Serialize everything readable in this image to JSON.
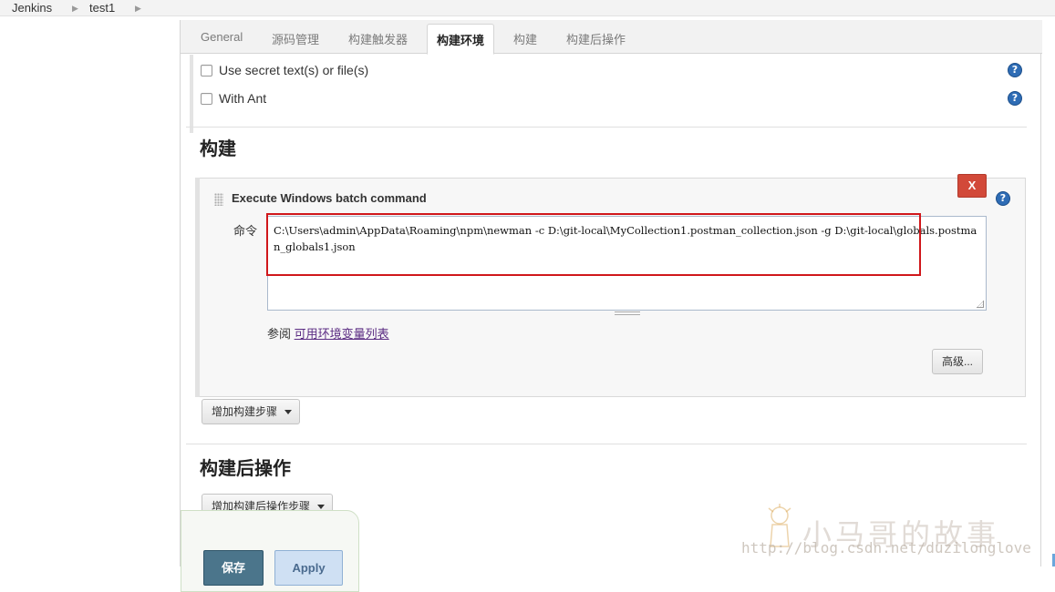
{
  "breadcrumb": {
    "items": [
      "Jenkins",
      "test1"
    ]
  },
  "tabs": [
    {
      "label": "General"
    },
    {
      "label": "源码管理"
    },
    {
      "label": "构建触发器"
    },
    {
      "label": "构建环境",
      "active": true
    },
    {
      "label": "构建"
    },
    {
      "label": "构建后操作"
    }
  ],
  "build_env": {
    "options": [
      {
        "label": "Use secret text(s) or file(s)",
        "checked": false
      },
      {
        "label": "With Ant",
        "checked": false
      }
    ]
  },
  "build": {
    "heading": "构建",
    "step": {
      "title": "Execute Windows batch command",
      "delete_label": "X",
      "command_label": "命令",
      "command_value": "C:\\Users\\admin\\AppData\\Roaming\\npm\\newman -c D:\\git-local\\MyCollection1.postman_collection.json -g D:\\git-local\\globals.postman_globals1.json",
      "ref_prefix": "参阅",
      "ref_link": "可用环境变量列表",
      "advanced_label": "高级..."
    },
    "add_step_label": "增加构建步骤"
  },
  "post_build": {
    "heading": "构建后操作",
    "add_step_label": "增加构建后操作步骤"
  },
  "actions": {
    "save_label": "保存",
    "apply_label": "Apply"
  },
  "watermark": {
    "name": "小马哥的故事",
    "url": "http://blog.csdn.net/duzilonglove"
  },
  "help_icon": "?",
  "colors": {
    "delete": "#d24939",
    "save": "#4b758b",
    "apply": "#cfe0f3",
    "highlight": "#d0171b",
    "help": "#2e6cb5"
  }
}
